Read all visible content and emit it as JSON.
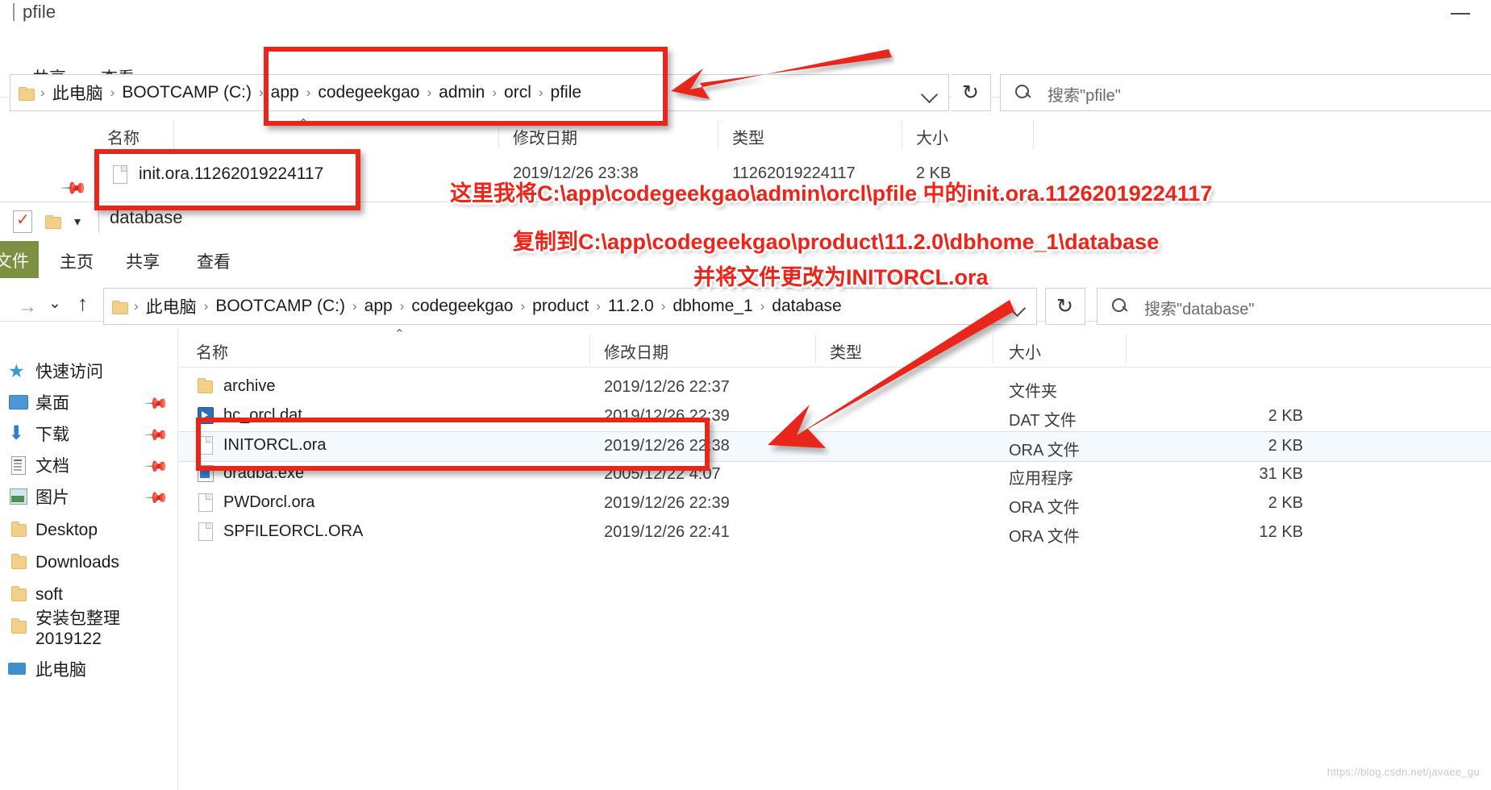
{
  "window1": {
    "title": "pfile",
    "minimize_icon": "minimize-icon",
    "ribbon_tabs": [
      {
        "label": "共享"
      },
      {
        "label": "查看"
      }
    ],
    "address": {
      "crumbs": [
        "此电脑",
        "BOOTCAMP (C:)",
        "app",
        "codegeekgao",
        "admin",
        "orcl",
        "pfile"
      ],
      "separator": "›",
      "dropdown_icon": "chevron-down-icon",
      "refresh_icon": "refresh-icon",
      "folder_icon": "folder-icon"
    },
    "search": {
      "placeholder": "搜索\"pfile\"",
      "icon": "search-icon"
    },
    "columns": [
      {
        "label": "名称"
      },
      {
        "label": "修改日期"
      },
      {
        "label": "类型"
      },
      {
        "label": "大小"
      }
    ],
    "sort_caret": "⌃",
    "rows": [
      {
        "name": "init.ora.11262019224117",
        "date": "2019/12/26 23:38",
        "type": "11262019224117",
        "size": "2 KB",
        "icon": "file-icon"
      }
    ],
    "pin_icon": "pin-icon"
  },
  "window2": {
    "titlebar": {
      "title": "database",
      "quick_access_check_icon": "checkbox-checked-icon",
      "quick_access_folder_icon": "folder-icon",
      "quick_access_caret": "▾"
    },
    "ribbon": {
      "file_tab": "文件",
      "tabs": [
        {
          "label": "主页"
        },
        {
          "label": "共享"
        },
        {
          "label": "查看"
        }
      ],
      "file_tab_color": "#7c9142"
    },
    "address": {
      "forward_icon": "arrow-right-icon",
      "history_icon": "chevron-down-icon",
      "up_icon": "arrow-up-icon",
      "folder_icon": "folder-icon",
      "crumbs": [
        "此电脑",
        "BOOTCAMP (C:)",
        "app",
        "codegeekgao",
        "product",
        "11.2.0",
        "dbhome_1",
        "database"
      ],
      "separator": "›",
      "dropdown_icon": "chevron-down-icon",
      "refresh_icon": "refresh-icon"
    },
    "search": {
      "placeholder": "搜索\"database\"",
      "icon": "search-icon"
    },
    "nav": {
      "items": [
        {
          "label": "快速访问",
          "icon": "star-icon",
          "pinned": false,
          "root": true
        },
        {
          "label": "桌面",
          "icon": "desktop-icon",
          "pinned": true
        },
        {
          "label": "下载",
          "icon": "download-icon",
          "pinned": true
        },
        {
          "label": "文档",
          "icon": "document-icon",
          "pinned": true
        },
        {
          "label": "图片",
          "icon": "pictures-icon",
          "pinned": true
        },
        {
          "label": "Desktop",
          "icon": "folder-icon",
          "pinned": false
        },
        {
          "label": "Downloads",
          "icon": "folder-icon",
          "pinned": false
        },
        {
          "label": "soft",
          "icon": "folder-icon",
          "pinned": false
        },
        {
          "label": "安装包整理2019122",
          "icon": "folder-icon",
          "pinned": false
        },
        {
          "label": "此电脑",
          "icon": "this-pc-icon",
          "pinned": false,
          "root": true
        }
      ],
      "pin_icon": "pin-icon"
    },
    "columns": [
      {
        "label": "名称"
      },
      {
        "label": "修改日期"
      },
      {
        "label": "类型"
      },
      {
        "label": "大小"
      }
    ],
    "sort_caret": "⌃",
    "rows": [
      {
        "name": "archive",
        "date": "2019/12/26 22:37",
        "type": "文件夹",
        "size": "",
        "icon": "folder-icon",
        "selected": false
      },
      {
        "name": "hc_orcl.dat",
        "date": "2019/12/26 22:39",
        "type": "DAT 文件",
        "size": "2 KB",
        "icon": "dat-file-icon",
        "selected": false
      },
      {
        "name": "INITORCL.ora",
        "date": "2019/12/26 22:38",
        "type": "ORA 文件",
        "size": "2 KB",
        "icon": "file-icon",
        "selected": true
      },
      {
        "name": "oradba.exe",
        "date": "2005/12/22 4:07",
        "type": "应用程序",
        "size": "31 KB",
        "icon": "exe-file-icon",
        "selected": false
      },
      {
        "name": "PWDorcl.ora",
        "date": "2019/12/26 22:39",
        "type": "ORA 文件",
        "size": "2 KB",
        "icon": "file-icon",
        "selected": false
      },
      {
        "name": "SPFILEORCL.ORA",
        "date": "2019/12/26 22:41",
        "type": "ORA 文件",
        "size": "12 KB",
        "icon": "file-icon",
        "selected": false
      }
    ]
  },
  "annotations": {
    "color": "#ef2318",
    "line1": "这里我将C:\\app\\codegeekgao\\admin\\orcl\\pfile 中的init.ora.11262019224117",
    "line2": "复制到C:\\app\\codegeekgao\\product\\11.2.0\\dbhome_1\\database",
    "line3": "并将文件更改为INITORCL.ora",
    "boxes": [
      {
        "name": "breadcrumb-highlight"
      },
      {
        "name": "init-ora-file-highlight"
      },
      {
        "name": "initorcl-ora-row-highlight"
      }
    ],
    "arrows": [
      {
        "name": "arrow-to-breadcrumb"
      },
      {
        "name": "arrow-to-initorcl"
      }
    ]
  },
  "watermark": "https://blog.csdn.net/javaee_gu"
}
